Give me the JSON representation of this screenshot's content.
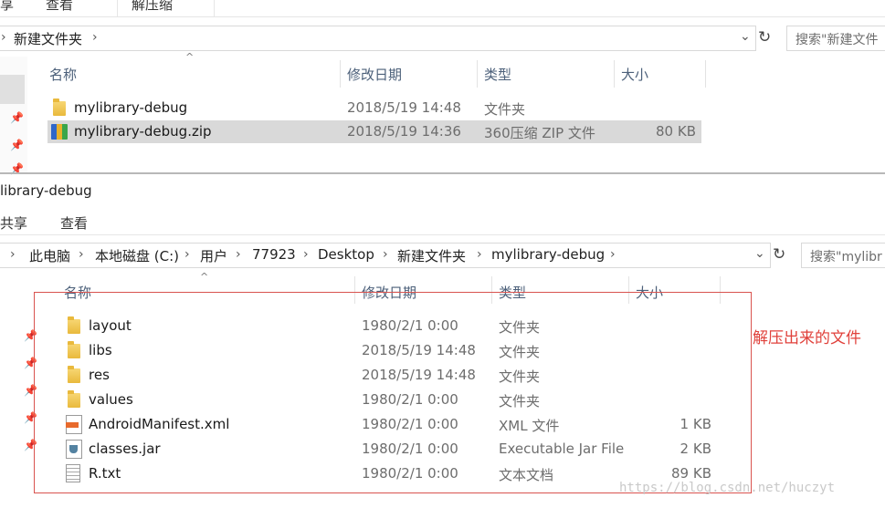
{
  "top_window": {
    "ribbon_tabs": [
      "享",
      "查看",
      "解压缩"
    ],
    "breadcrumb": [
      "新建文件夹"
    ],
    "search_placeholder": "搜索\"新建文件",
    "columns": {
      "name": "名称",
      "date": "修改日期",
      "type": "类型",
      "size": "大小"
    },
    "files": [
      {
        "name": "mylibrary-debug",
        "date": "2018/5/19 14:48",
        "type": "文件夹",
        "size": "",
        "icon": "folder-icon"
      },
      {
        "name": "mylibrary-debug.zip",
        "date": "2018/5/19 14:36",
        "type": "360压缩 ZIP 文件",
        "size": "80 KB",
        "icon": "zip-archive-icon",
        "selected": true
      }
    ]
  },
  "bottom_window": {
    "title": "library-debug",
    "ribbon_tabs": [
      "共享",
      "查看"
    ],
    "breadcrumb": [
      "此电脑",
      "本地磁盘 (C:)",
      "用户",
      "77923",
      "Desktop",
      "新建文件夹",
      "mylibrary-debug"
    ],
    "search_placeholder": "搜索\"mylibr",
    "columns": {
      "name": "名称",
      "date": "修改日期",
      "type": "类型",
      "size": "大小"
    },
    "files": [
      {
        "name": "layout",
        "date": "1980/2/1 0:00",
        "type": "文件夹",
        "size": "",
        "icon": "folder-icon"
      },
      {
        "name": "libs",
        "date": "2018/5/19 14:48",
        "type": "文件夹",
        "size": "",
        "icon": "folder-icon"
      },
      {
        "name": "res",
        "date": "2018/5/19 14:48",
        "type": "文件夹",
        "size": "",
        "icon": "folder-icon"
      },
      {
        "name": "values",
        "date": "1980/2/1 0:00",
        "type": "文件夹",
        "size": "",
        "icon": "folder-icon"
      },
      {
        "name": "AndroidManifest.xml",
        "date": "1980/2/1 0:00",
        "type": "XML 文件",
        "size": "1 KB",
        "icon": "xml-file-icon"
      },
      {
        "name": "classes.jar",
        "date": "1980/2/1 0:00",
        "type": "Executable Jar File",
        "size": "2 KB",
        "icon": "jar-file-icon"
      },
      {
        "name": "R.txt",
        "date": "1980/2/1 0:00",
        "type": "文本文档",
        "size": "89 KB",
        "icon": "text-file-icon"
      }
    ],
    "annotation": "解压出来的文件"
  },
  "watermark": "https://blog.csdn.net/huczyt",
  "colors": {
    "annotation_red": "#e0413b",
    "selection": "#d9d9d9",
    "header_text": "#4c607a"
  }
}
